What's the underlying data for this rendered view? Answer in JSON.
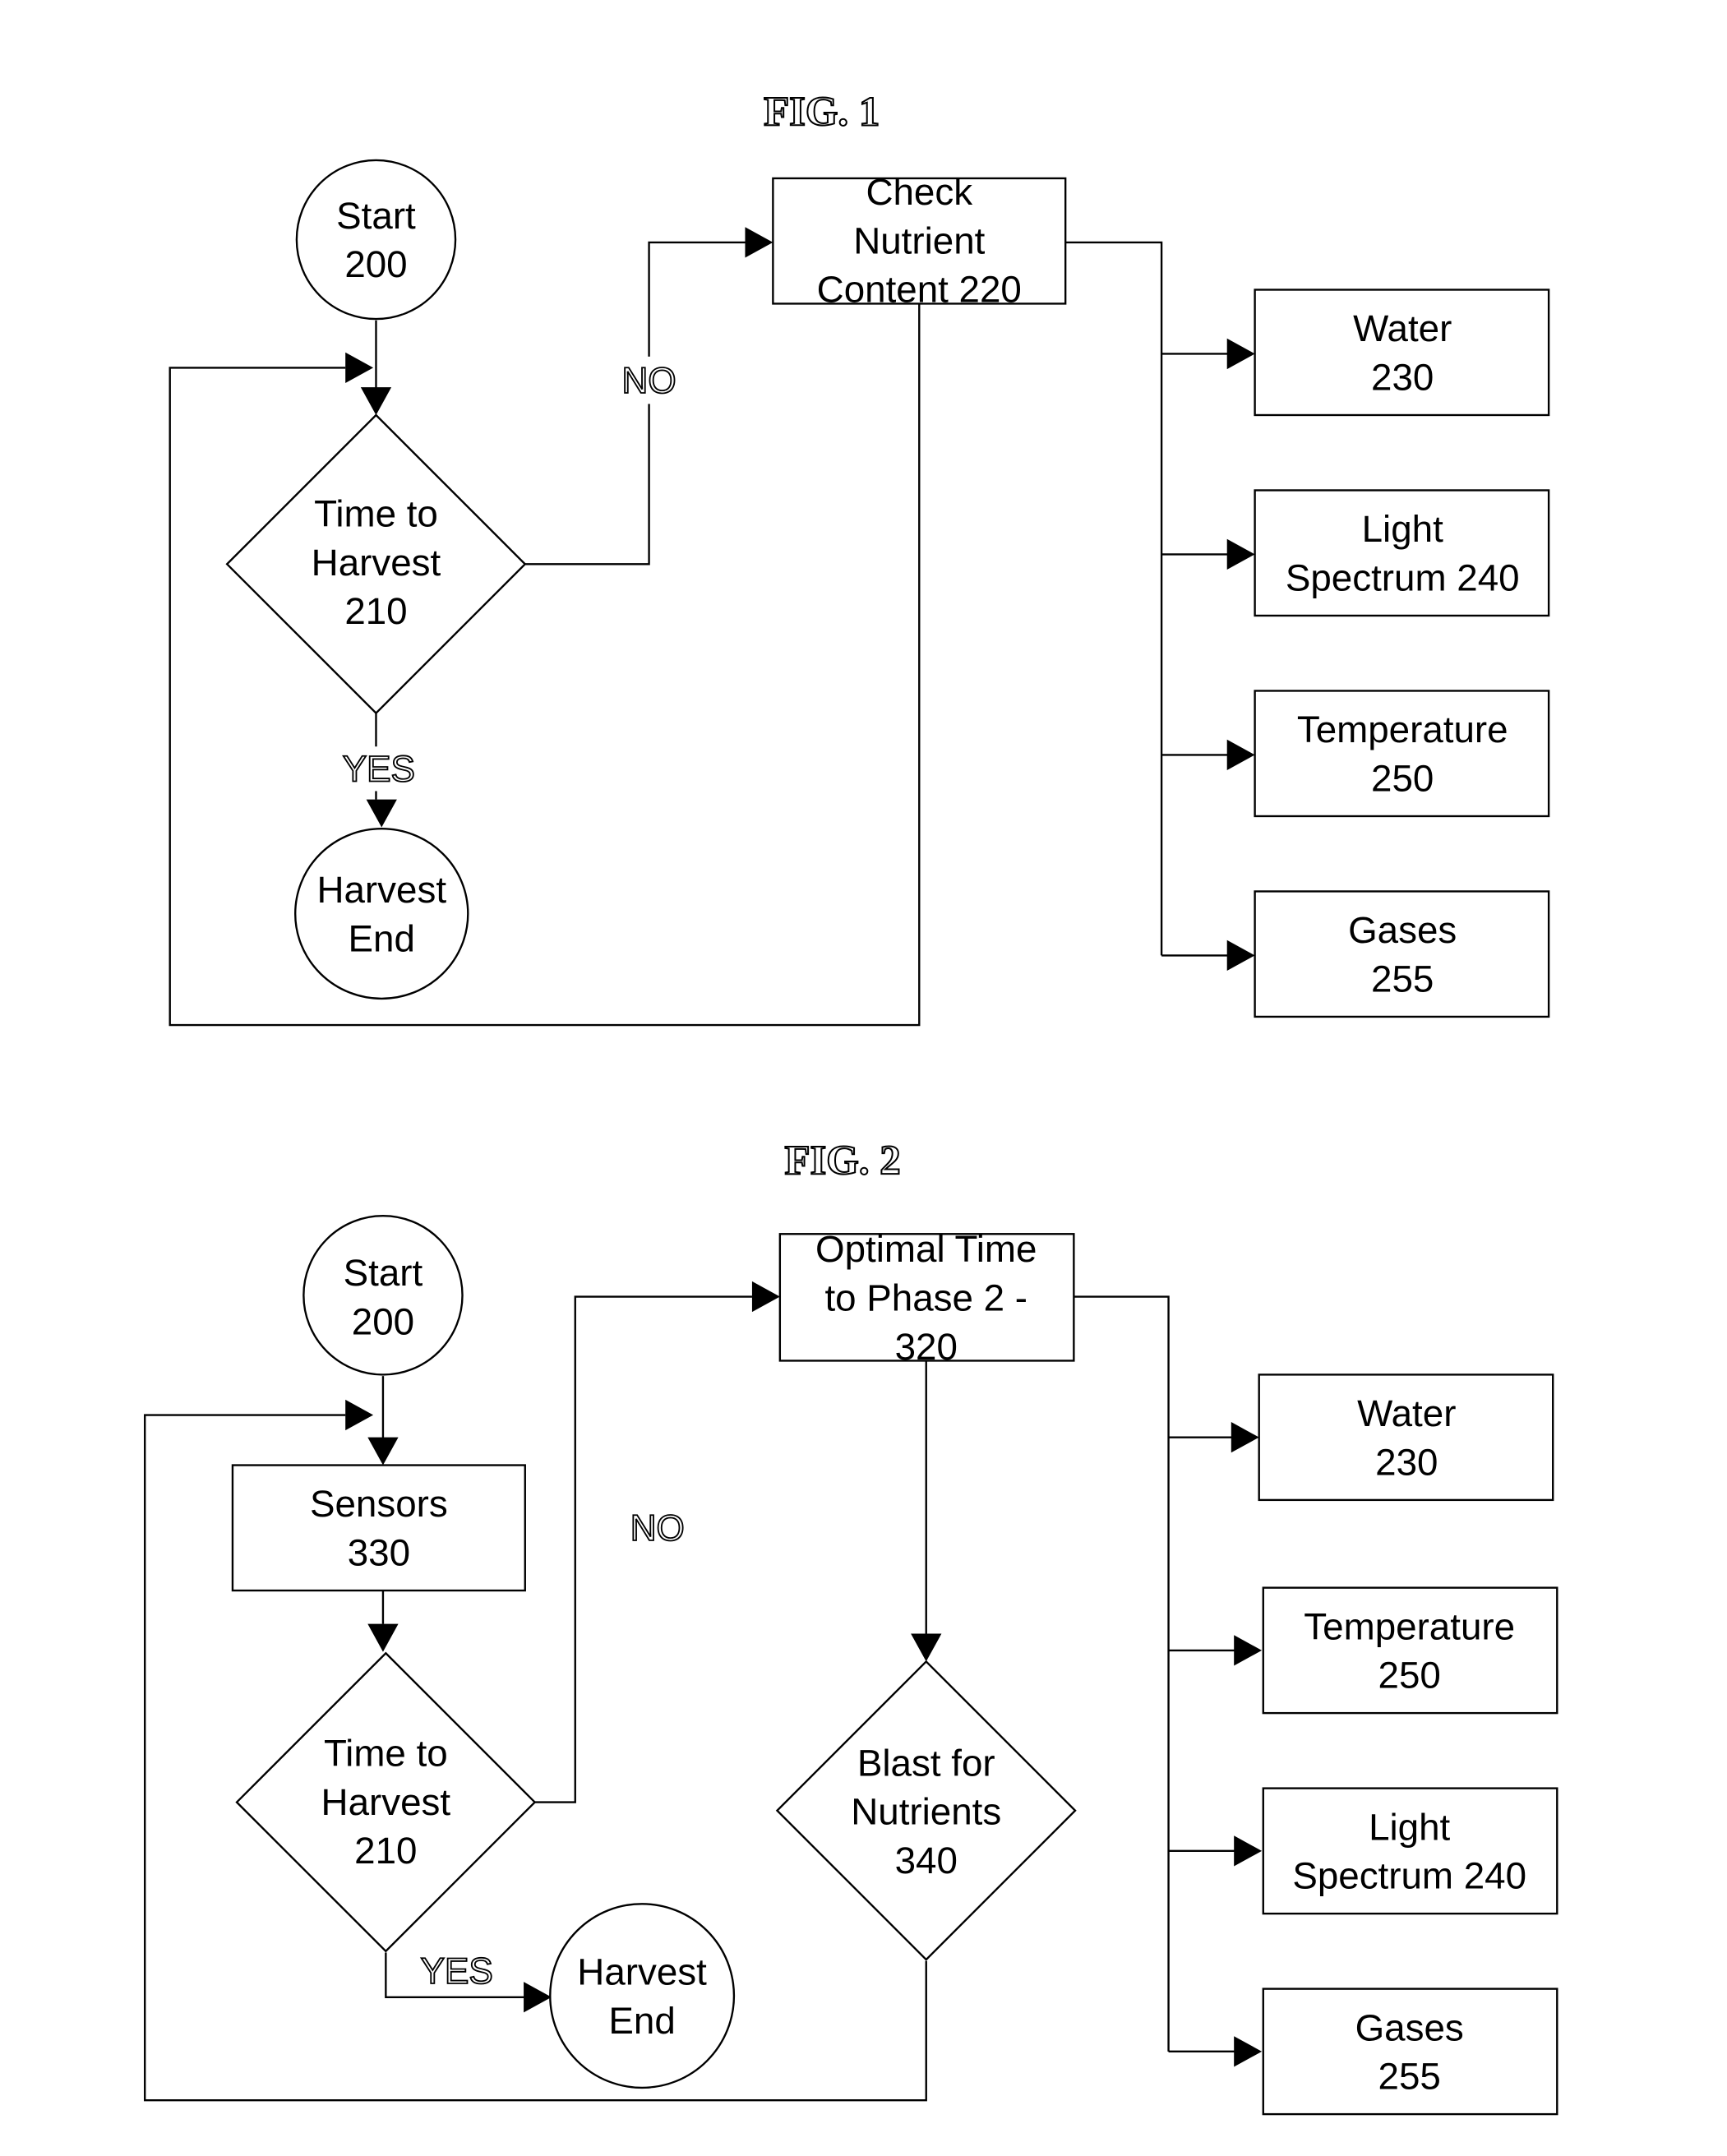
{
  "figures": [
    {
      "title": "FIG. 1",
      "nodes": {
        "start": [
          "Start",
          "200"
        ],
        "decision": [
          "Time to",
          "Harvest",
          "210"
        ],
        "harvest_end": [
          "Harvest",
          "End"
        ],
        "process": [
          "Check",
          "Nutrient",
          "Content 220"
        ],
        "water": [
          "Water",
          "230"
        ],
        "light": [
          "Light",
          "Spectrum 240"
        ],
        "temperature": [
          "Temperature",
          "250"
        ],
        "gases": [
          "Gases",
          "255"
        ]
      },
      "edges": {
        "no": "NO",
        "yes": "YES"
      }
    },
    {
      "title": "FIG. 2",
      "nodes": {
        "start": [
          "Start",
          "200"
        ],
        "sensors": [
          "Sensors",
          "330"
        ],
        "decision": [
          "Time to",
          "Harvest",
          "210"
        ],
        "harvest_end": [
          "Harvest",
          "End"
        ],
        "process": [
          "Optimal Time",
          "to Phase 2 -",
          "320"
        ],
        "blast": [
          "Blast for",
          "Nutrients",
          "340"
        ],
        "water": [
          "Water",
          "230"
        ],
        "temperature": [
          "Temperature",
          "250"
        ],
        "light": [
          "Light",
          "Spectrum 240"
        ],
        "gases": [
          "Gases",
          "255"
        ]
      },
      "edges": {
        "no": "NO",
        "yes": "YES"
      }
    }
  ]
}
